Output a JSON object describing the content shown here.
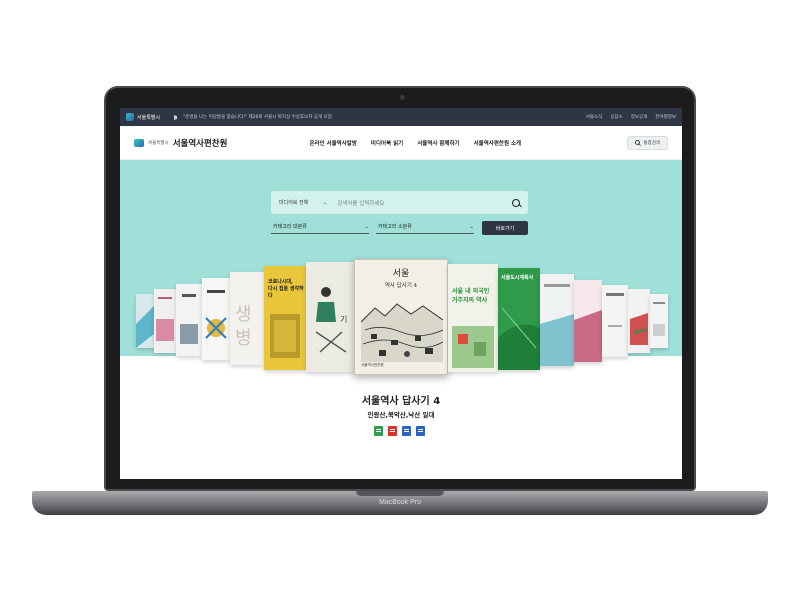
{
  "device": {
    "label": "MacBook Pro"
  },
  "topbar": {
    "logo_text": "서울특별시",
    "notice": "\"운명을 나는 미담발을 찾습니다!\" 제28회 서울시 복지상 수상후보자 공개 모집",
    "links": [
      "서울소식",
      "응답소",
      "정보공개",
      "분야별정보"
    ]
  },
  "header": {
    "brand_city": "서울특별시",
    "brand_name": "서울역사편찬원",
    "nav": [
      "온라인 서울역사칼방",
      "미디어북 읽기",
      "서울역사 함께하기",
      "서울역사편찬원 소개"
    ],
    "search_button": "통합검색"
  },
  "search": {
    "scope": "미디어북 전체",
    "placeholder": "검색어를 입력하세요",
    "category_major": "카테고리 대분류",
    "category_minor": "카테고리 소분류",
    "go_button": "바로가기"
  },
  "covers": {
    "main_title": "서울",
    "main_subtitle": "역사 답사기 4",
    "main_publisher": "서울역사편찬원",
    "left_text_1": "코로나시대,\n다시 집을 생각하다",
    "left_text_2": "생·병",
    "right_text_1": "서울 내 외국인\n거주지의 역사",
    "right_text_2": "서울도시계획사"
  },
  "selected_book": {
    "title": "서울역사 답사기 4",
    "subtitle": "인왕산,북악산,낙산 일대"
  },
  "colors": {
    "topbar": "#2f3542",
    "hero": "#9fe0d9",
    "button_dark": "#2f3542",
    "format_epub": "#2e9e4e",
    "format_pdf": "#d9342b",
    "format_doc": "#2b62c4",
    "format_word": "#2b62c4"
  },
  "format_icons": [
    "epub-icon",
    "pdf-icon",
    "document-icon",
    "word-icon"
  ]
}
